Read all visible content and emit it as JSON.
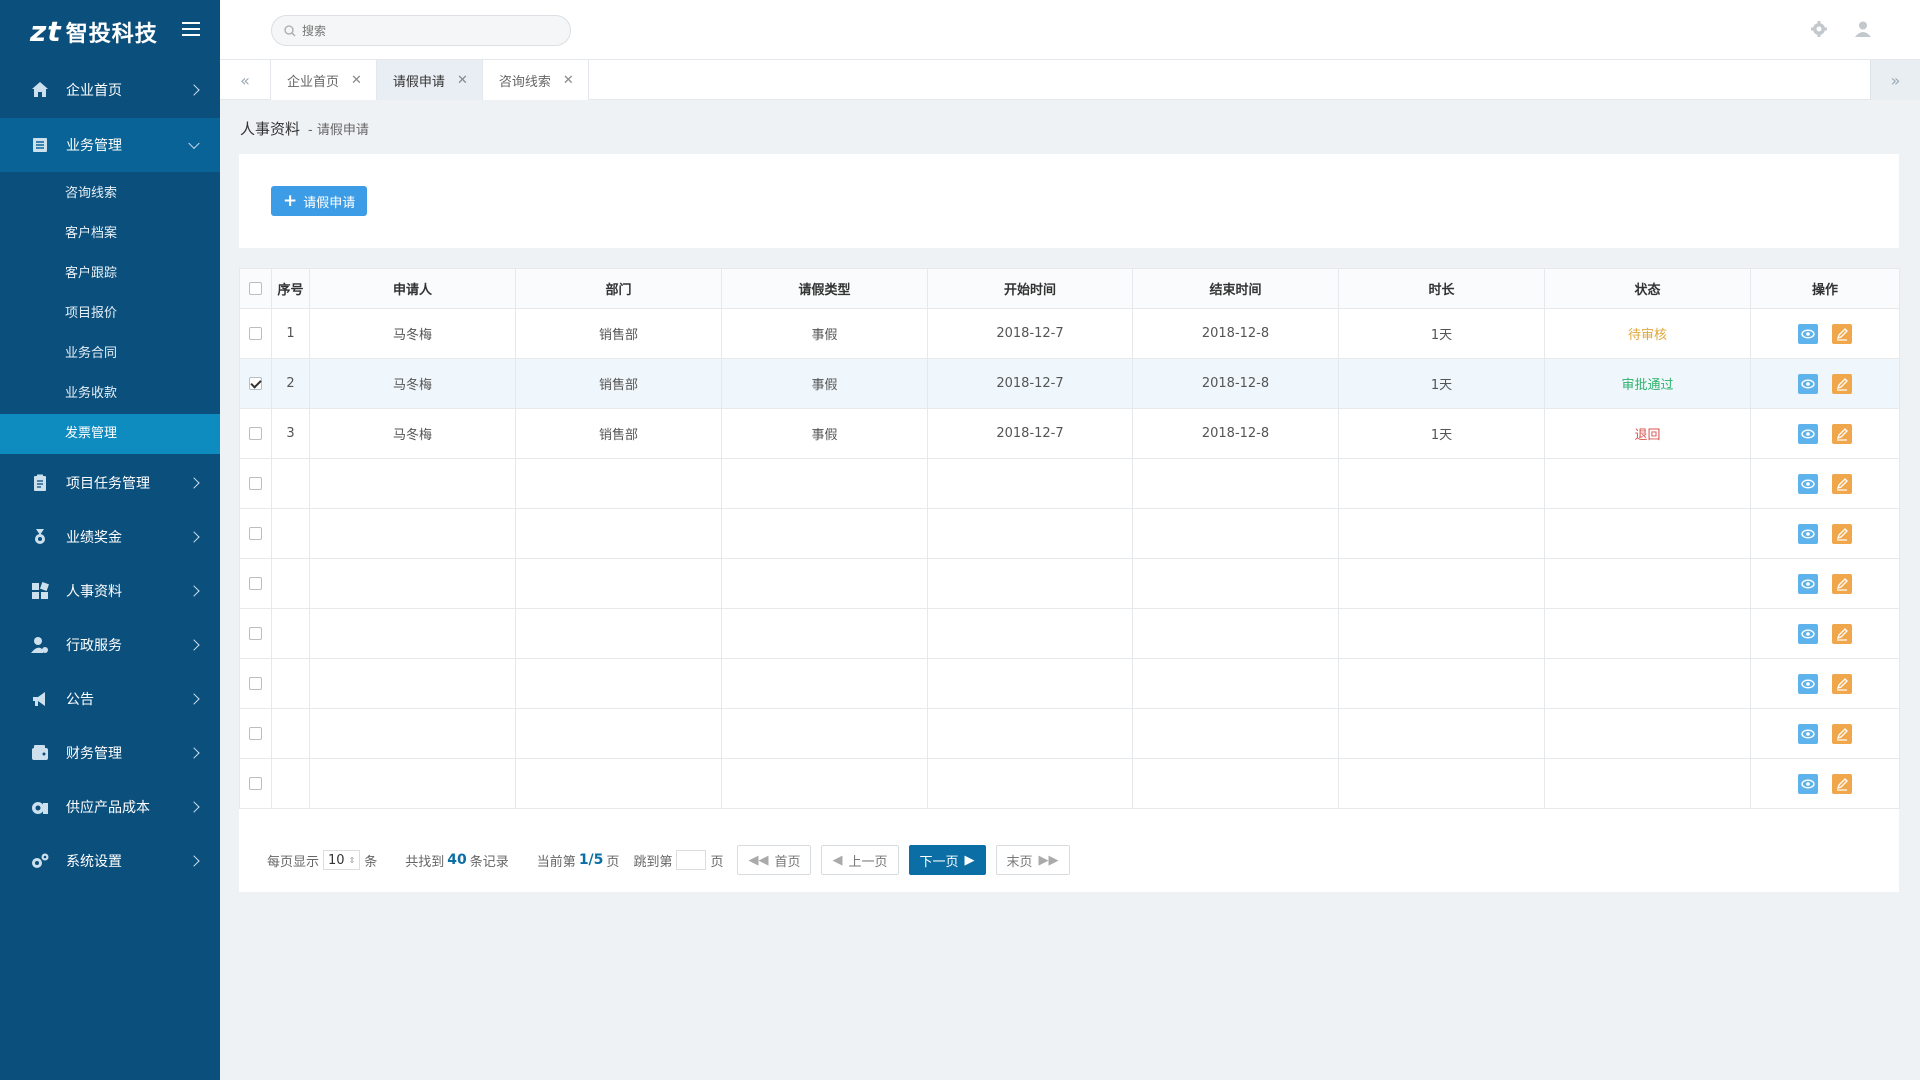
{
  "brand": {
    "logo": "zt",
    "name": "智投科技"
  },
  "sidebar": {
    "items": [
      {
        "label": "企业首页",
        "icon": "home-icon"
      },
      {
        "label": "业务管理",
        "icon": "list-icon",
        "open": true,
        "children": [
          "咨询线索",
          "客户档案",
          "客户跟踪",
          "项目报价",
          "业务合同",
          "业务收款",
          "发票管理"
        ],
        "active_child": 6
      },
      {
        "label": "项目任务管理",
        "icon": "clipboard-icon"
      },
      {
        "label": "业绩奖金",
        "icon": "medal-icon"
      },
      {
        "label": "人事资料",
        "icon": "grid-icon"
      },
      {
        "label": "行政服务",
        "icon": "user-gear-icon"
      },
      {
        "label": "公告",
        "icon": "megaphone-icon"
      },
      {
        "label": "财务管理",
        "icon": "wallet-icon"
      },
      {
        "label": "供应产品成本",
        "icon": "coins-icon"
      },
      {
        "label": "系统设置",
        "icon": "gears-icon"
      }
    ]
  },
  "search": {
    "placeholder": "搜索"
  },
  "tabs": [
    {
      "label": "企业首页",
      "active": false
    },
    {
      "label": "请假申请",
      "active": true
    },
    {
      "label": "咨询线索",
      "active": false
    }
  ],
  "breadcrumb": {
    "main": "人事资料",
    "sub": "- 请假申请"
  },
  "toolbar": {
    "add_label": "请假申请"
  },
  "table": {
    "headers": [
      "序号",
      "申请人",
      "部门",
      "请假类型",
      "开始时间",
      "结束时间",
      "时长",
      "状态",
      "操作"
    ],
    "rows": [
      {
        "no": "1",
        "applicant": "马冬梅",
        "dept": "销售部",
        "type": "事假",
        "start": "2018-12-7",
        "end": "2018-12-8",
        "duration": "1天",
        "status": "待审核",
        "status_kind": "pending",
        "checked": false
      },
      {
        "no": "2",
        "applicant": "马冬梅",
        "dept": "销售部",
        "type": "事假",
        "start": "2018-12-7",
        "end": "2018-12-8",
        "duration": "1天",
        "status": "审批通过",
        "status_kind": "ok",
        "checked": true
      },
      {
        "no": "3",
        "applicant": "马冬梅",
        "dept": "销售部",
        "type": "事假",
        "start": "2018-12-7",
        "end": "2018-12-8",
        "duration": "1天",
        "status": "退回",
        "status_kind": "back",
        "checked": false
      }
    ],
    "empty_rows": 7
  },
  "pager": {
    "per_page_label": "每页显示",
    "per_page": "10",
    "per_page_unit": "条",
    "found_prefix": "共找到",
    "total": "40",
    "found_suffix": "条记录",
    "current_prefix": "当前第",
    "current": "1/5",
    "current_suffix": "页",
    "jump_prefix": "跳到第",
    "jump_suffix": "页",
    "first": "首页",
    "prev": "上一页",
    "next": "下一页",
    "last": "末页"
  },
  "colors": {
    "sidebar": "#0b4f7d",
    "accent": "#0b6fa6",
    "pending": "#e0a83b",
    "ok": "#2cb36b",
    "back": "#d9534f"
  }
}
